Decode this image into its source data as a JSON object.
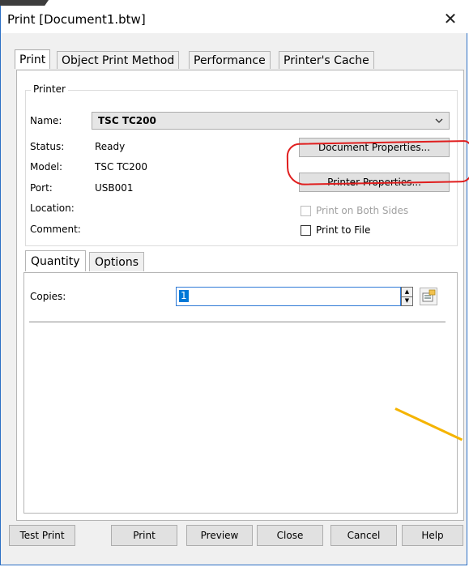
{
  "window": {
    "title": "Print [Document1.btw]",
    "close_glyph": "✕"
  },
  "tabs": [
    "Print",
    "Object Print Method",
    "Performance",
    "Printer's Cache"
  ],
  "printer_group": {
    "legend": "Printer",
    "name_label": "Name:",
    "name_value": "TSC TC200",
    "status_label": "Status:",
    "status_value": "Ready",
    "model_label": "Model:",
    "model_value": "TSC TC200",
    "port_label": "Port:",
    "port_value": "USB001",
    "location_label": "Location:",
    "comment_label": "Comment:",
    "document_properties": "Document Properties...",
    "printer_properties": "Printer Properties...",
    "print_both_sides": "Print on Both Sides",
    "print_to_file": "Print to File"
  },
  "quantity_tabs": [
    "Quantity",
    "Options"
  ],
  "quantity": {
    "copies_label": "Copies:",
    "copies_value": "1"
  },
  "footer": {
    "test_print": "Test Print",
    "print": "Print",
    "preview": "Preview",
    "close": "Close",
    "cancel": "Cancel",
    "help": "Help"
  },
  "colors": {
    "annotation_circle": "#e01e1e",
    "annotation_line": "#f5b400",
    "selection": "#0078d7",
    "window_border": "#2b6fc5"
  },
  "icons": {
    "close": "close-icon",
    "dropdown": "chevron-down-icon",
    "spin_up": "spin-up-icon",
    "spin_down": "spin-down-icon",
    "variable": "variable-icon"
  }
}
